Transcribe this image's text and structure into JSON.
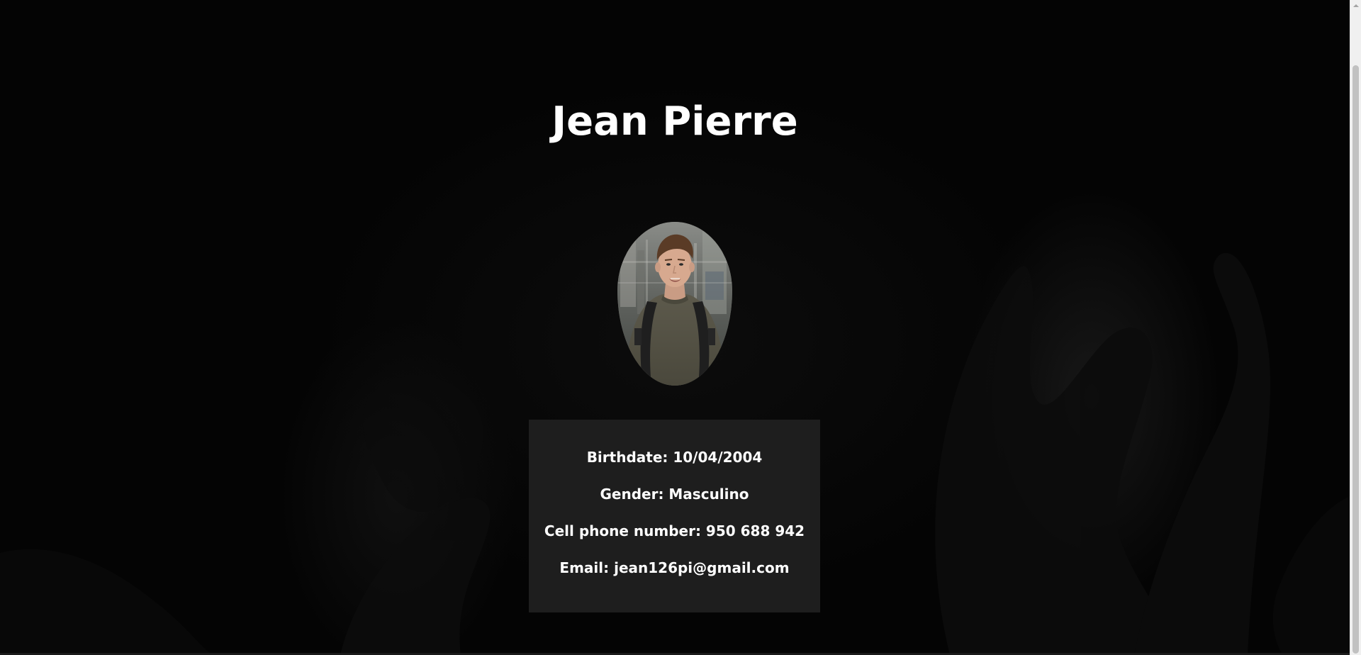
{
  "profile": {
    "name": "Jean Pierre",
    "photo_alt": "profile-photo"
  },
  "info": {
    "birthdate": "Birthdate: 10/04/2004",
    "gender": "Gender: Masculino",
    "phone": "Cell phone number: 950 688 942",
    "email": "Email: jean126pi@gmail.com"
  },
  "colors": {
    "background": "#050505",
    "card": "#1e1e1e",
    "text": "#ffffff",
    "scrollbar_track": "#f0f0f0",
    "scrollbar_thumb": "#c1c1c1"
  },
  "icons": {
    "scroll_up": "chevron-up-icon"
  }
}
